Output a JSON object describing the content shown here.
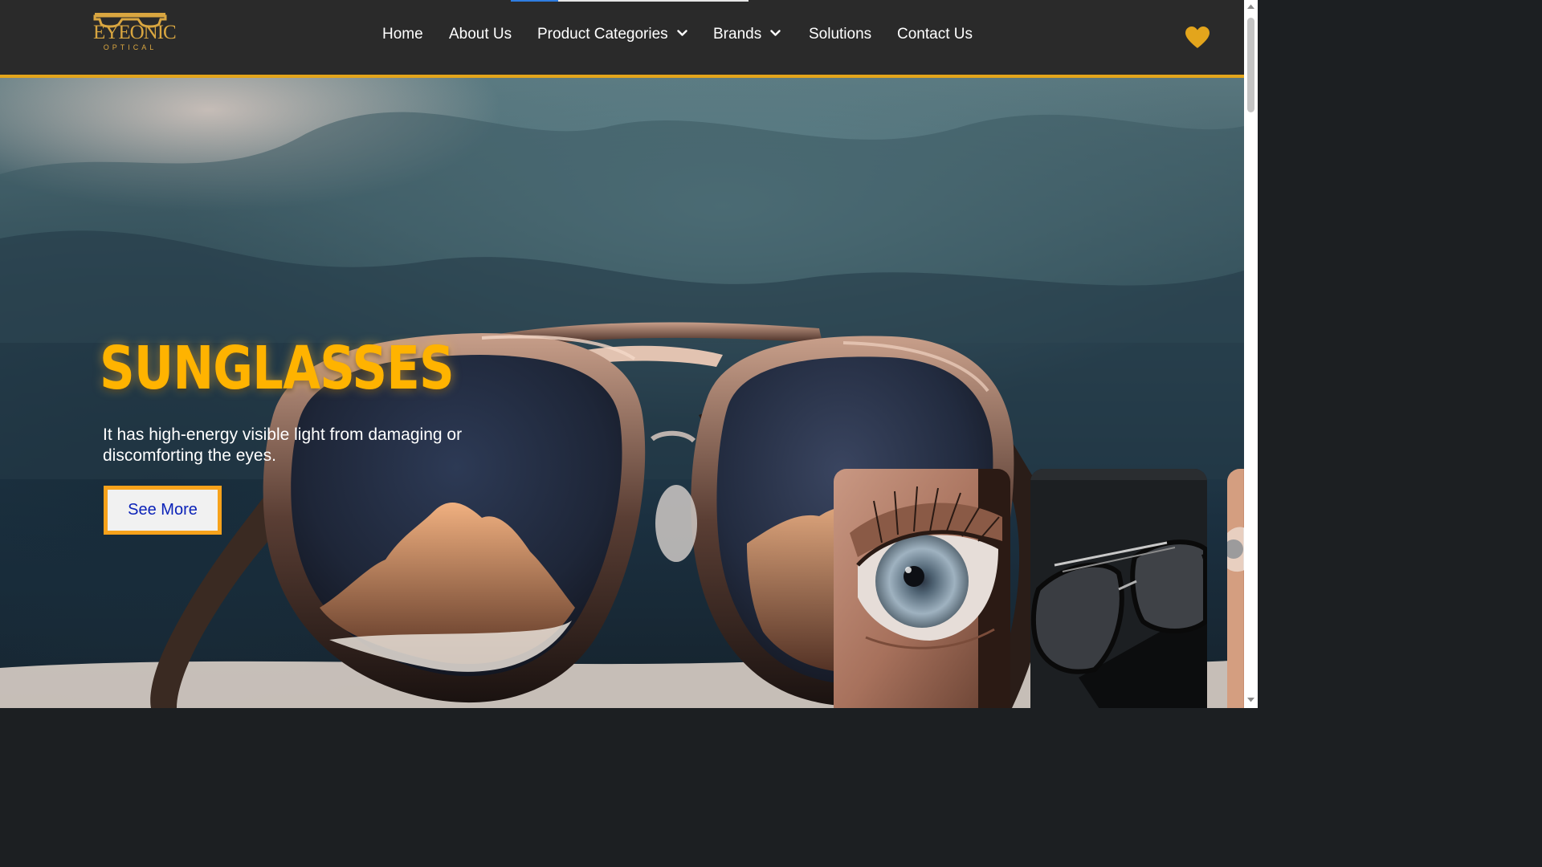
{
  "header": {
    "logo": {
      "word": "EYEONIC",
      "sub": "OPTICAL"
    },
    "progress": 0.2,
    "nav": [
      {
        "label": "Home",
        "has_dropdown": false
      },
      {
        "label": "About Us",
        "has_dropdown": false
      },
      {
        "label": "Product Categories",
        "has_dropdown": true
      },
      {
        "label": "Brands",
        "has_dropdown": true
      },
      {
        "label": "Solutions",
        "has_dropdown": false
      },
      {
        "label": "Contact Us",
        "has_dropdown": false
      }
    ],
    "wishlist_icon": "heart-icon"
  },
  "hero": {
    "title": "SUNGLASSES",
    "description": "It has high-energy visible light from damaging or discomforting the eyes.",
    "button_label": "See More",
    "slides": [
      {
        "icon": "eye-closeup-image"
      },
      {
        "icon": "black-eyeglasses-image"
      },
      {
        "icon": "partial-eye-image"
      }
    ]
  },
  "colors": {
    "header_bg": "#2a2a2a",
    "accent": "#e3a51c",
    "title": "#ffb300",
    "button_text": "#0b22b8",
    "button_border": "#f7a21b"
  }
}
